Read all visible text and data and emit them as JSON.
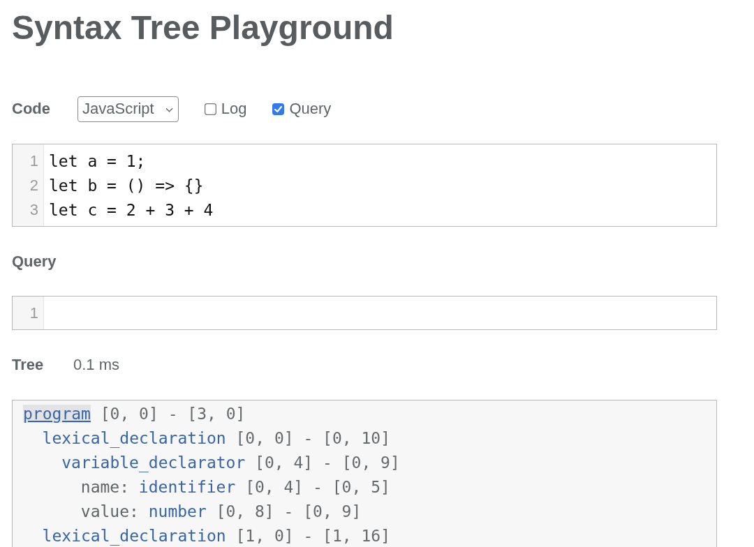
{
  "title": "Syntax Tree Playground",
  "code_section": {
    "label": "Code",
    "language_select": {
      "value": "JavaScript"
    },
    "options": [
      {
        "label": "Log",
        "checked": false
      },
      {
        "label": "Query",
        "checked": true
      }
    ]
  },
  "code_editor": {
    "lines": [
      {
        "number": "1",
        "text": "let a = 1;"
      },
      {
        "number": "2",
        "text": "let b = () => {}"
      },
      {
        "number": "3",
        "text": "let c = 2 + 3 + 4"
      }
    ]
  },
  "query_section": {
    "label": "Query",
    "editor": {
      "lines": [
        {
          "number": "1"
        }
      ]
    }
  },
  "tree_section": {
    "label": "Tree",
    "timing": "0.1 ms",
    "nodes": [
      {
        "type": "program",
        "range": "[0, 0] - [3, 0]",
        "selected": true,
        "children": [
          {
            "type": "lexical_declaration",
            "range": "[0, 0] - [0, 10]",
            "selected": false,
            "children": [
              {
                "type": "variable_declarator",
                "range": "[0, 4] - [0, 9]",
                "selected": false,
                "children": [
                  {
                    "field": "name:",
                    "type": "identifier",
                    "range": "[0, 4] - [0, 5]",
                    "selected": false
                  },
                  {
                    "field": "value:",
                    "type": "number",
                    "range": "[0, 8] - [0, 9]",
                    "selected": false
                  }
                ]
              }
            ]
          },
          {
            "type": "lexical_declaration",
            "range": "[1, 0] - [1, 16]",
            "selected": false
          }
        ]
      }
    ]
  }
}
